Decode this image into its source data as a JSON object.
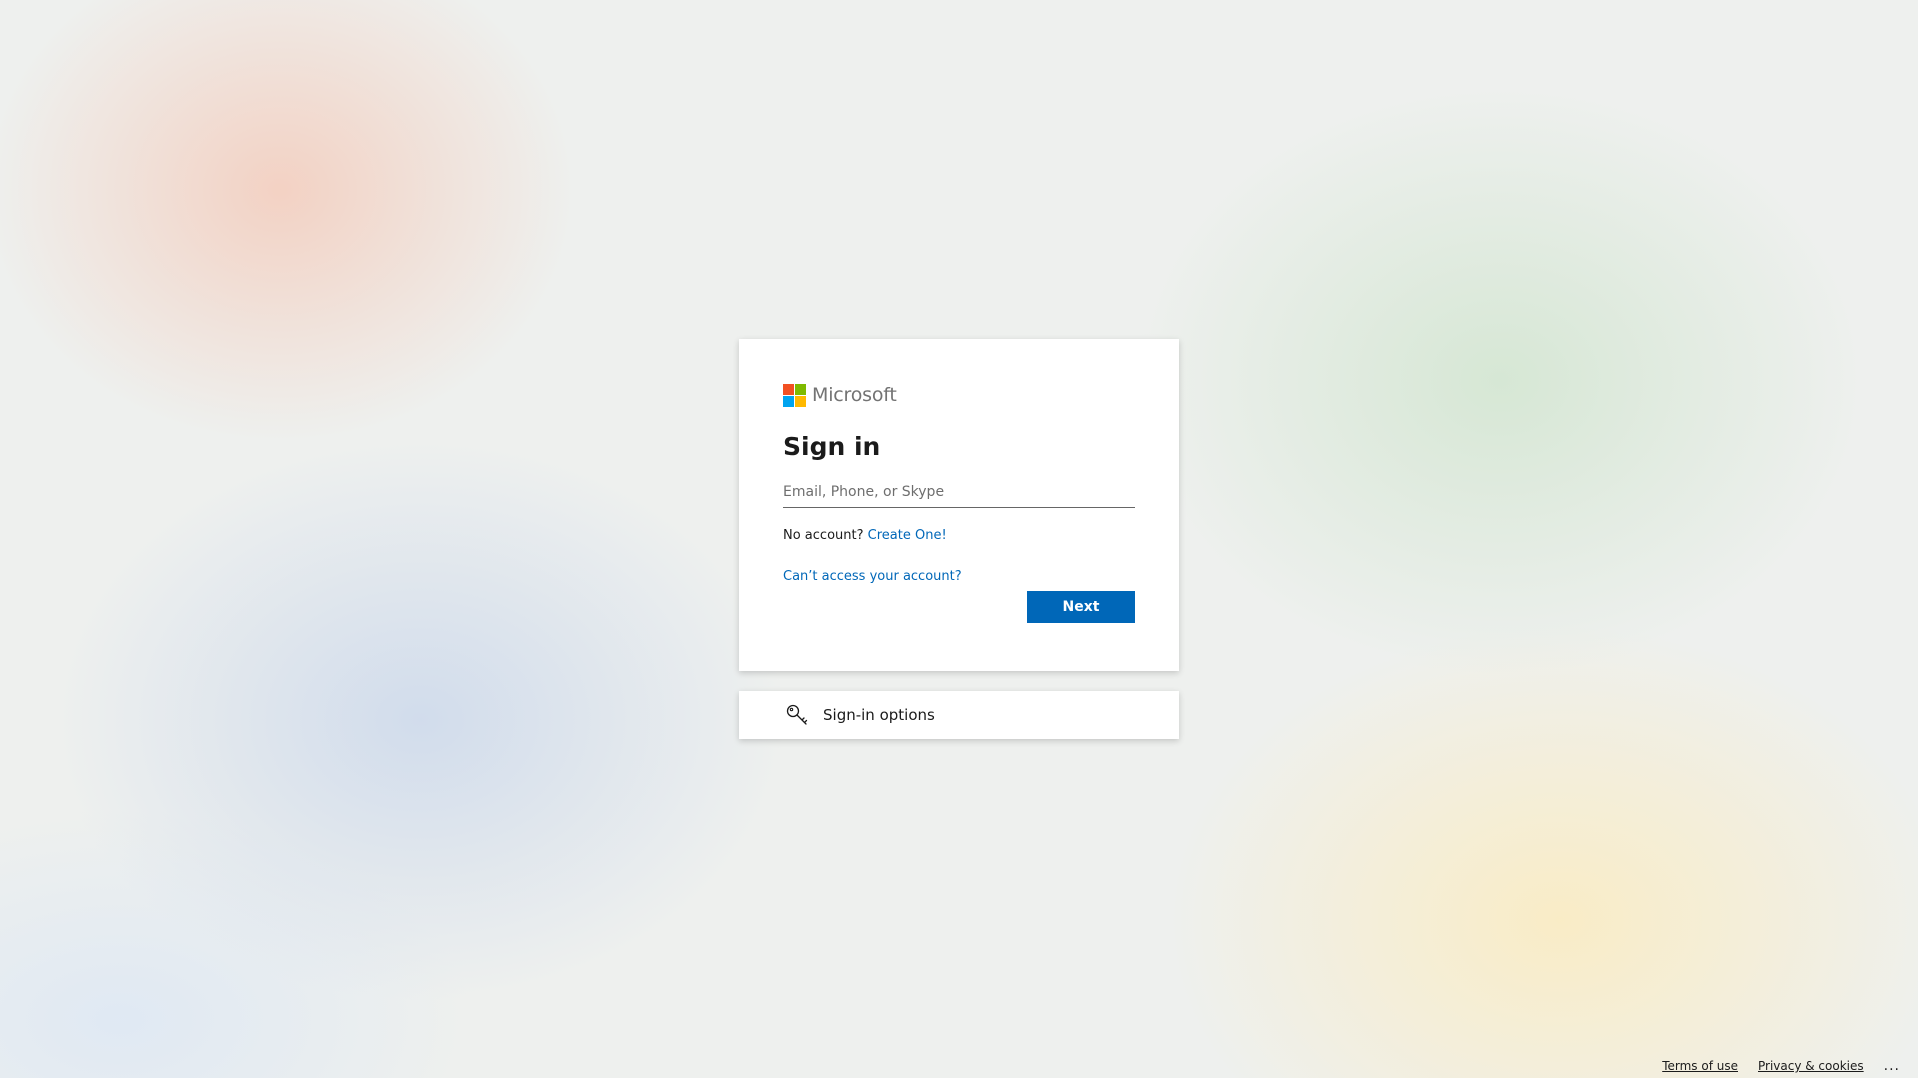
{
  "brand": {
    "name": "Microsoft",
    "logo_colors": [
      "#f25022",
      "#7fba00",
      "#00a4ef",
      "#ffb900"
    ]
  },
  "signin": {
    "title": "Sign in",
    "email_placeholder": "Email, Phone, or Skype",
    "email_value": "",
    "no_account_text": "No account?",
    "create_link": "Create One!",
    "cant_access_link": "Can’t access your account?",
    "next_label": "Next"
  },
  "options": {
    "label": "Sign-in options",
    "icon": "key-icon"
  },
  "footer": {
    "terms": "Terms of use",
    "privacy": "Privacy & cookies",
    "more": "..."
  },
  "colors": {
    "accent": "#0067b8",
    "text": "#1b1b1b"
  }
}
